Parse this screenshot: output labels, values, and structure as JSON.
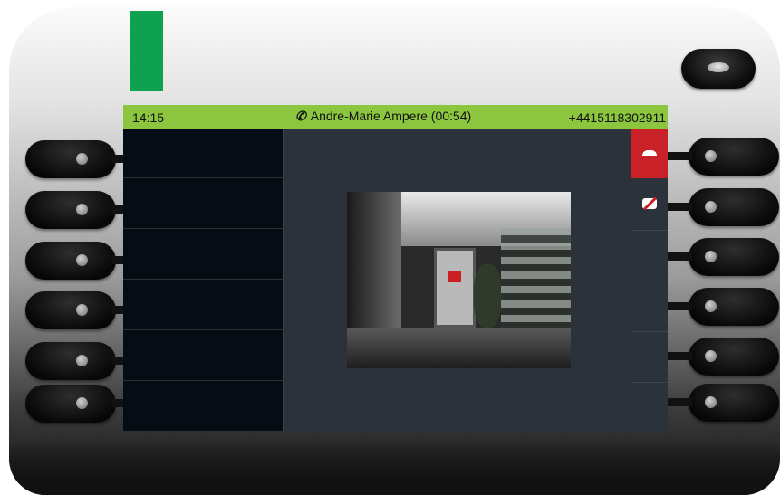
{
  "device": {
    "led_color": "#0ea14f",
    "accent_status_color": "#8cc63f",
    "hangup_color": "#c92128"
  },
  "status_bar": {
    "time": "14:15",
    "caller": "Andre-Marie Ampere (00:54)",
    "caller_icon": "handset-icon",
    "number": "+4415118302911"
  },
  "left_keys": [
    "",
    "",
    "",
    "",
    "",
    ""
  ],
  "right_keys": [
    {
      "icon": "hangup-icon",
      "label": ""
    },
    {
      "icon": "video-off-icon",
      "label": ""
    },
    {
      "icon": "",
      "label": ""
    },
    {
      "icon": "",
      "label": ""
    },
    {
      "icon": "",
      "label": ""
    },
    {
      "icon": "",
      "label": ""
    }
  ],
  "video": {
    "content": "video-feed"
  }
}
